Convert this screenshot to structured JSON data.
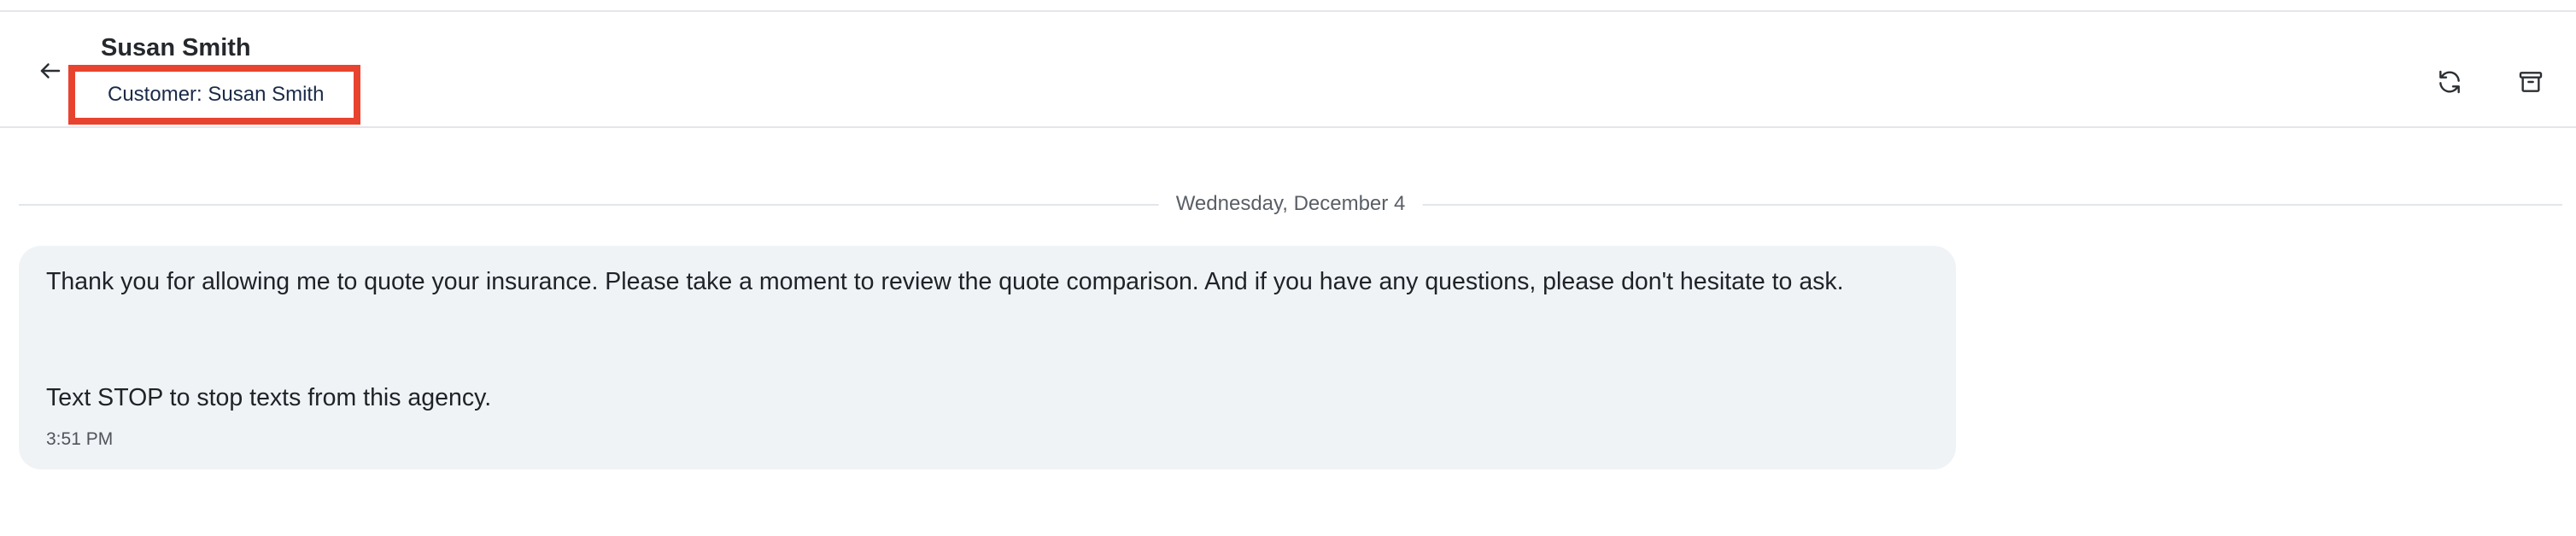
{
  "header": {
    "back_icon": "arrow-left-icon",
    "contact_name": "Susan Smith",
    "customer_label": "Customer: Susan Smith",
    "highlight_color": "#e8432e",
    "actions": {
      "refresh_icon": "refresh-icon",
      "archive_icon": "archive-icon"
    }
  },
  "conversation": {
    "date_label": "Wednesday, December 4",
    "messages": [
      {
        "lines": [
          "Thank you for allowing me to quote your insurance. Please take a moment to review the quote comparison. And if you have any questions, please don't hesitate to ask.",
          "Text STOP to stop texts from this agency."
        ],
        "time": "3:51 PM",
        "bubble_color": "#f0f3f6"
      }
    ]
  }
}
